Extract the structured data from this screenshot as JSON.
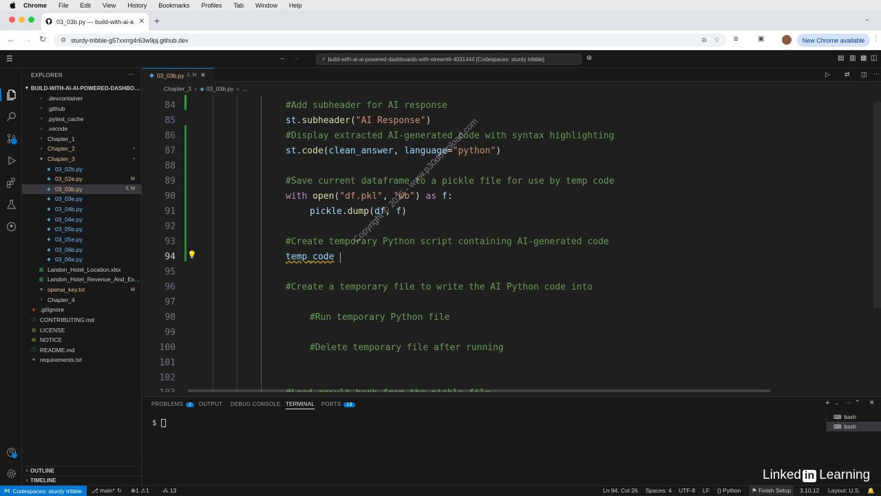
{
  "mac_menu": {
    "app": "Chrome",
    "items": [
      "File",
      "Edit",
      "View",
      "History",
      "Bookmarks",
      "Profiles",
      "Tab",
      "Window",
      "Help"
    ]
  },
  "browser": {
    "tab_title": "03_03b.py — build-with-ai-a",
    "url": "sturdy-tribble-g57xxrrg4r63w9pj.github.dev",
    "new_chrome": "New Chrome available"
  },
  "vscode": {
    "command_center": "build-with-ai-ai-powered-dashboards-with-streamlit-4031444 [Codespaces: sturdy tribble]",
    "explorer_title": "EXPLORER",
    "root_folder": "BUILD-WITH-AI-AI-POWERED-DASHBOA...",
    "tree": [
      {
        "label": ".devcontainer",
        "type": "folder",
        "depth": 1,
        "badge": ""
      },
      {
        "label": ".github",
        "type": "folder",
        "depth": 1,
        "badge": ""
      },
      {
        "label": ".pytest_cache",
        "type": "folder",
        "depth": 1,
        "badge": ""
      },
      {
        "label": ".vscode",
        "type": "folder",
        "depth": 1,
        "badge": ""
      },
      {
        "label": "Chapter_1",
        "type": "folder",
        "depth": 1,
        "badge": ""
      },
      {
        "label": "Chapter_2",
        "type": "folder",
        "depth": 1,
        "badge": "•"
      },
      {
        "label": "Chapter_3",
        "type": "folder-open",
        "depth": 1,
        "badge": "•"
      },
      {
        "label": "03_02b.py",
        "type": "py",
        "depth": 2,
        "badge": ""
      },
      {
        "label": "03_02e.py",
        "type": "py",
        "depth": 2,
        "badge": "M"
      },
      {
        "label": "03_03b.py",
        "type": "py",
        "depth": 2,
        "badge": "2, M"
      },
      {
        "label": "03_03e.py",
        "type": "py",
        "depth": 2,
        "badge": ""
      },
      {
        "label": "03_04b.py",
        "type": "py",
        "depth": 2,
        "badge": ""
      },
      {
        "label": "03_04e.py",
        "type": "py",
        "depth": 2,
        "badge": ""
      },
      {
        "label": "03_05b.py",
        "type": "py",
        "depth": 2,
        "badge": ""
      },
      {
        "label": "03_05e.py",
        "type": "py",
        "depth": 2,
        "badge": ""
      },
      {
        "label": "03_06b.py",
        "type": "py",
        "depth": 2,
        "badge": ""
      },
      {
        "label": "03_06e.py",
        "type": "py",
        "depth": 2,
        "badge": ""
      },
      {
        "label": "Landon_Hotel_Location.xlsx",
        "type": "xlsx",
        "depth": 1,
        "badge": ""
      },
      {
        "label": "Landon_Hotel_Revenue_And_Exp...",
        "type": "xlsx",
        "depth": 1,
        "badge": ""
      },
      {
        "label": "openai_key.txt",
        "type": "txt",
        "depth": 1,
        "badge": "M"
      },
      {
        "label": "Chapter_4",
        "type": "folder",
        "depth": 1,
        "badge": ""
      },
      {
        "label": ".gitignore",
        "type": "git",
        "depth": 0,
        "badge": ""
      },
      {
        "label": "CONTRIBUTING.md",
        "type": "md",
        "depth": 0,
        "badge": ""
      },
      {
        "label": "LICENSE",
        "type": "lic",
        "depth": 0,
        "badge": ""
      },
      {
        "label": "NOTICE",
        "type": "lic",
        "depth": 0,
        "badge": ""
      },
      {
        "label": "README.md",
        "type": "md",
        "depth": 0,
        "badge": ""
      },
      {
        "label": "requirements.txt",
        "type": "txt",
        "depth": 0,
        "badge": ""
      }
    ],
    "outline_label": "OUTLINE",
    "timeline_label": "TIMELINE",
    "editor_tab": "03_03b.py",
    "editor_tab_badge": "2, M",
    "breadcrumb": [
      "Chapter_3",
      "03_03b.py",
      "..."
    ],
    "code_lines": [
      {
        "n": "84",
        "segs": [
          [
            "#Add subheader for AI response",
            "cm"
          ]
        ],
        "indent": 0
      },
      {
        "n": "85",
        "segs": [
          [
            "st.",
            "var"
          ],
          [
            "subheader",
            "fn"
          ],
          [
            "(",
            ""
          ],
          [
            "\"AI Response\"",
            "str"
          ],
          [
            ")",
            ""
          ]
        ],
        "indent": 0
      },
      {
        "n": "86",
        "segs": [
          [
            "#Display extracted AI-generated code with syntax highlighting",
            "cm"
          ]
        ],
        "indent": 0
      },
      {
        "n": "87",
        "segs": [
          [
            "st.",
            "var"
          ],
          [
            "code",
            "fn"
          ],
          [
            "(",
            ""
          ],
          [
            "clean_answer",
            "var"
          ],
          [
            ", ",
            ""
          ],
          [
            "language",
            "var"
          ],
          [
            "=",
            ""
          ],
          [
            "\"python\"",
            "str"
          ],
          [
            ")",
            ""
          ]
        ],
        "indent": 0
      },
      {
        "n": "88",
        "segs": [],
        "indent": 0
      },
      {
        "n": "89",
        "segs": [
          [
            "#Save current dataframe to a pickle file for use by temp code",
            "cm"
          ]
        ],
        "indent": 0
      },
      {
        "n": "90",
        "segs": [
          [
            "with ",
            "kw"
          ],
          [
            "open",
            "fn"
          ],
          [
            "(",
            ""
          ],
          [
            "\"df.pkl\"",
            "str"
          ],
          [
            ", ",
            ""
          ],
          [
            "\"wb\"",
            "str"
          ],
          [
            ") ",
            ""
          ],
          [
            "as ",
            "kw"
          ],
          [
            "f",
            "var"
          ],
          [
            ":",
            ""
          ]
        ],
        "indent": 0
      },
      {
        "n": "91",
        "segs": [
          [
            "pickle.",
            "var"
          ],
          [
            "dump",
            "fn"
          ],
          [
            "(",
            ""
          ],
          [
            "df",
            "var"
          ],
          [
            ", ",
            ""
          ],
          [
            "f",
            "var"
          ],
          [
            ")",
            ""
          ]
        ],
        "indent": 1
      },
      {
        "n": "92",
        "segs": [],
        "indent": 0
      },
      {
        "n": "93",
        "segs": [
          [
            "#Create temporary Python script containing AI-generated code",
            "cm"
          ]
        ],
        "indent": 0
      },
      {
        "n": "94",
        "segs": [
          [
            "temp_code",
            "var"
          ]
        ],
        "indent": 0
      },
      {
        "n": "95",
        "segs": [],
        "indent": 0
      },
      {
        "n": "96",
        "segs": [
          [
            "#Create a temporary file to write the AI Python code into",
            "cm"
          ]
        ],
        "indent": 0
      },
      {
        "n": "97",
        "segs": [],
        "indent": 0
      },
      {
        "n": "98",
        "segs": [
          [
            "#Run temporary Python file",
            "cm"
          ]
        ],
        "indent": 1
      },
      {
        "n": "99",
        "segs": [],
        "indent": 0
      },
      {
        "n": "100",
        "segs": [
          [
            "#Delete temporary file after running",
            "cm"
          ]
        ],
        "indent": 1
      },
      {
        "n": "101",
        "segs": [],
        "indent": 0
      },
      {
        "n": "102",
        "segs": [],
        "indent": 0
      },
      {
        "n": "103",
        "segs": [
          [
            "#Load result back from the pickle file",
            "cm"
          ]
        ],
        "indent": 0
      }
    ],
    "watermark": "Copyright © 2025 - www.p30download.com",
    "panel_tabs": [
      {
        "label": "PROBLEMS",
        "badge": "2"
      },
      {
        "label": "OUTPUT",
        "badge": ""
      },
      {
        "label": "DEBUG CONSOLE",
        "badge": ""
      },
      {
        "label": "TERMINAL",
        "badge": ""
      },
      {
        "label": "PORTS",
        "badge": "13"
      }
    ],
    "terminal_prompt": "$",
    "terminal_sessions": [
      "bash",
      "bash"
    ],
    "status": {
      "remote": "Codespaces: sturdy tribble",
      "branch": "main*",
      "errors": "1",
      "warnings": "1",
      "ports": "13",
      "position": "Ln 94, Col 26",
      "spaces": "Spaces: 4",
      "encoding": "UTF-8",
      "eol": "LF",
      "language": "Python",
      "finish_setup": "Finish Setup",
      "python_version": "3.10.12",
      "layout": "Layout: U.S."
    }
  },
  "brand": {
    "pre": "Linked",
    "in": "in",
    "post": "Learning"
  }
}
